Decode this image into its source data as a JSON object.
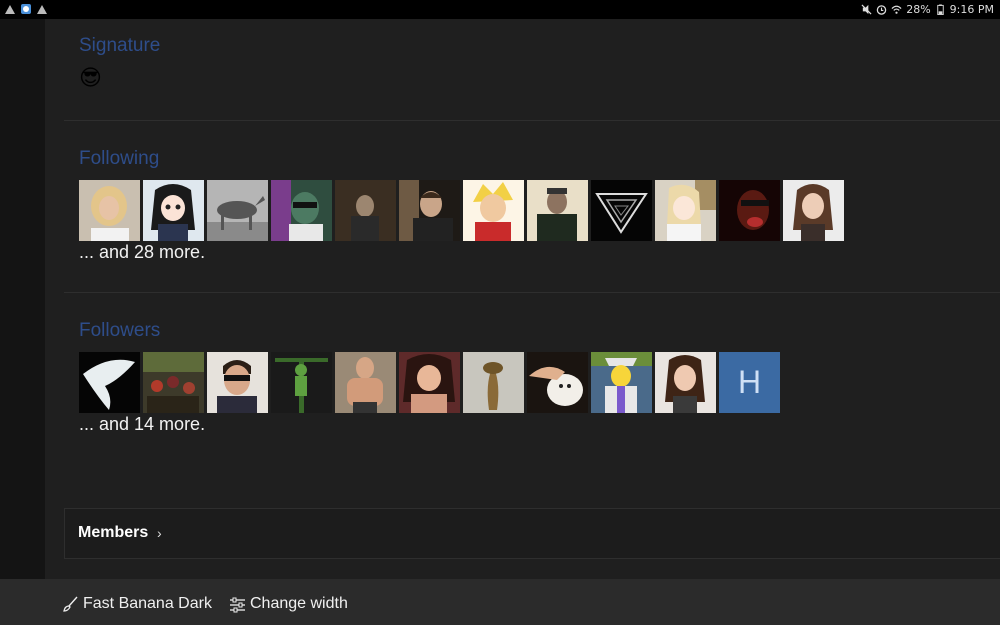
{
  "status_bar": {
    "battery": "28%",
    "time": "9:16 PM"
  },
  "signature": {
    "title": "Signature",
    "emoji": "😎"
  },
  "following": {
    "title": "Following",
    "more": "... and 28 more."
  },
  "followers": {
    "title": "Followers",
    "more": "... and 14 more.",
    "letter_avatar": "H"
  },
  "members": {
    "label": "Members",
    "chevron": "›"
  },
  "footer": {
    "style_label": "Fast Banana Dark",
    "width_label": "Change width"
  },
  "colors": {
    "section_title": "#2e4d8a",
    "letter_avatar_bg": "#3b6aa3",
    "background": "#1f1f1f"
  }
}
